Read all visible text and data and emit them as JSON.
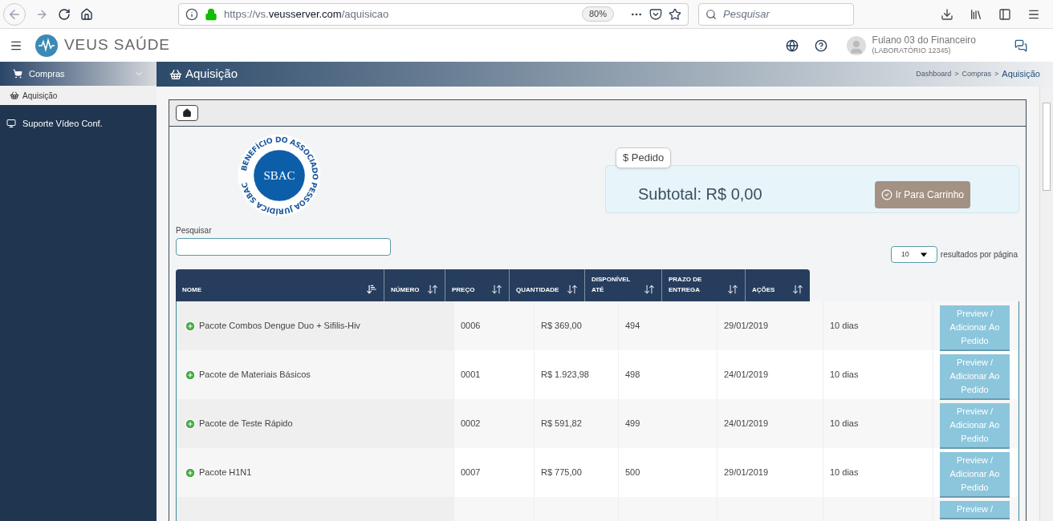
{
  "browser": {
    "url_prefix": "https://vs.",
    "url_domain": "veusserver.com",
    "url_path": "/aquisicao",
    "zoom": "80%",
    "search_placeholder": "Pesquisar"
  },
  "header": {
    "logo": "VEUS SAÚDE",
    "user_name": "Fulano 03 do Financeiro",
    "user_org": "(LABORATÓRIO 12345)"
  },
  "sidebar": {
    "items": [
      {
        "label": "Compras",
        "kind": "group",
        "expanded": true,
        "children": [
          {
            "label": "Aquisição",
            "selected": true
          }
        ]
      },
      {
        "label": "Suporte Vídeo Conf.",
        "kind": "link"
      }
    ]
  },
  "page": {
    "title": "Aquisição",
    "breadcrumb": [
      {
        "label": "Dashboard",
        "current": false
      },
      {
        "label": "Compras",
        "current": false
      },
      {
        "label": "Aquisição",
        "current": true
      }
    ],
    "separator": ">"
  },
  "badge": {
    "ring_text": "BENEFÍCIO DO ASSOCIADO PESSOA JURÍDICA SBAC",
    "center": "SBAC"
  },
  "order": {
    "tab": "$ Pedido",
    "subtotal": "Subtotal: R$ 0,00",
    "cart_button": "Ir Para Carrinho"
  },
  "search": {
    "label": "Pesquisar"
  },
  "page_size": {
    "value": "10",
    "label": "resultados por página"
  },
  "table": {
    "columns": [
      {
        "label": "NOME",
        "sorted": true
      },
      {
        "label": "NÚMERO",
        "sorted": false
      },
      {
        "label": "PREÇO",
        "sorted": false
      },
      {
        "label": "QUANTIDADE",
        "sorted": false
      },
      {
        "label": "DISPONÍVEL ATÉ",
        "sorted": false
      },
      {
        "label": "PRAZO DE ENTREGA",
        "sorted": false
      },
      {
        "label": "AÇÕES",
        "sorted": false
      }
    ],
    "rows": [
      {
        "name": "Pacote Combos Dengue Duo + Sifilis-Hiv",
        "number": "0006",
        "price": "R$ 369,00",
        "quantity": "494",
        "date": "29/01/2019",
        "delivery": "10 dias",
        "action": "Preview / Adicionar Ao Pedido"
      },
      {
        "name": "Pacote de Materiais Básicos",
        "number": "0001",
        "price": "R$ 1.923,98",
        "quantity": "498",
        "date": "24/01/2019",
        "delivery": "10 dias",
        "action": "Preview / Adicionar Ao Pedido"
      },
      {
        "name": "Pacote de Teste Rápido",
        "number": "0002",
        "price": "R$ 591,82",
        "quantity": "499",
        "date": "24/01/2019",
        "delivery": "10 dias",
        "action": "Preview / Adicionar Ao Pedido"
      },
      {
        "name": "Pacote H1N1",
        "number": "0007",
        "price": "R$ 775,00",
        "quantity": "500",
        "date": "29/01/2019",
        "delivery": "10 dias",
        "action": "Preview / Adicionar Ao Pedido"
      },
      {
        "name": "",
        "number": "",
        "price": "",
        "quantity": "",
        "date": "",
        "delivery": "",
        "action": "Preview /"
      }
    ]
  }
}
